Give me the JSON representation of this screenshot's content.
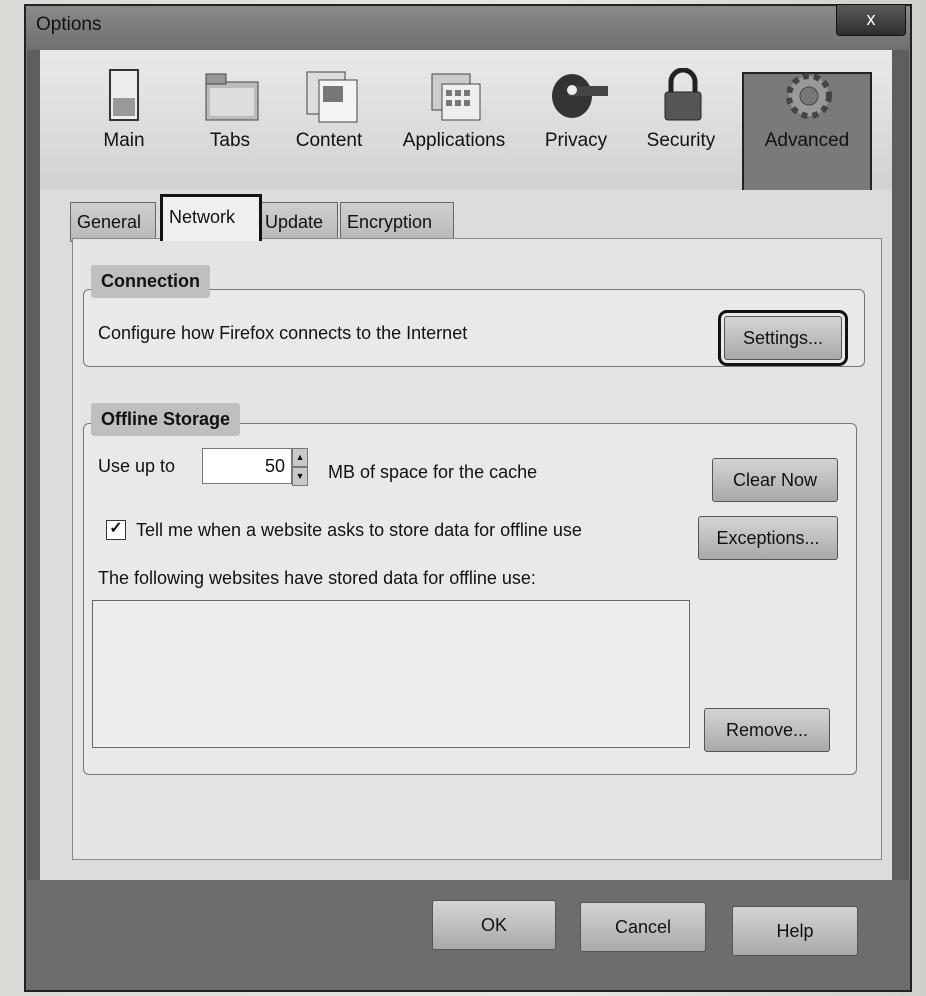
{
  "window": {
    "title": "Options",
    "close_label": "x"
  },
  "toolbar": {
    "items": [
      {
        "label": "Main",
        "icon": "switch-icon"
      },
      {
        "label": "Tabs",
        "icon": "folder-tabs-icon"
      },
      {
        "label": "Content",
        "icon": "content-icon"
      },
      {
        "label": "Applications",
        "icon": "applications-icon"
      },
      {
        "label": "Privacy",
        "icon": "mask-icon"
      },
      {
        "label": "Security",
        "icon": "padlock-icon"
      },
      {
        "label": "Advanced",
        "icon": "gear-icon",
        "selected": true
      }
    ]
  },
  "subtabs": [
    "General",
    "Network",
    "Update",
    "Encryption"
  ],
  "active_subtab": "Network",
  "connection": {
    "legend": "Connection",
    "description": "Configure how Firefox connects to the Internet",
    "settings_button": "Settings..."
  },
  "offline": {
    "legend": "Offline Storage",
    "use_up_to": "Use up to",
    "cache_value": "50",
    "cache_suffix": "MB of space for the cache",
    "clear_now_button": "Clear Now",
    "tell_me_label": "Tell me when a website asks to store data for offline use",
    "tell_me_checked": true,
    "exceptions_button": "Exceptions...",
    "stored_label": "The following websites have stored data for offline use:",
    "remove_button": "Remove..."
  },
  "buttons": {
    "ok": "OK",
    "cancel": "Cancel",
    "help": "Help"
  }
}
